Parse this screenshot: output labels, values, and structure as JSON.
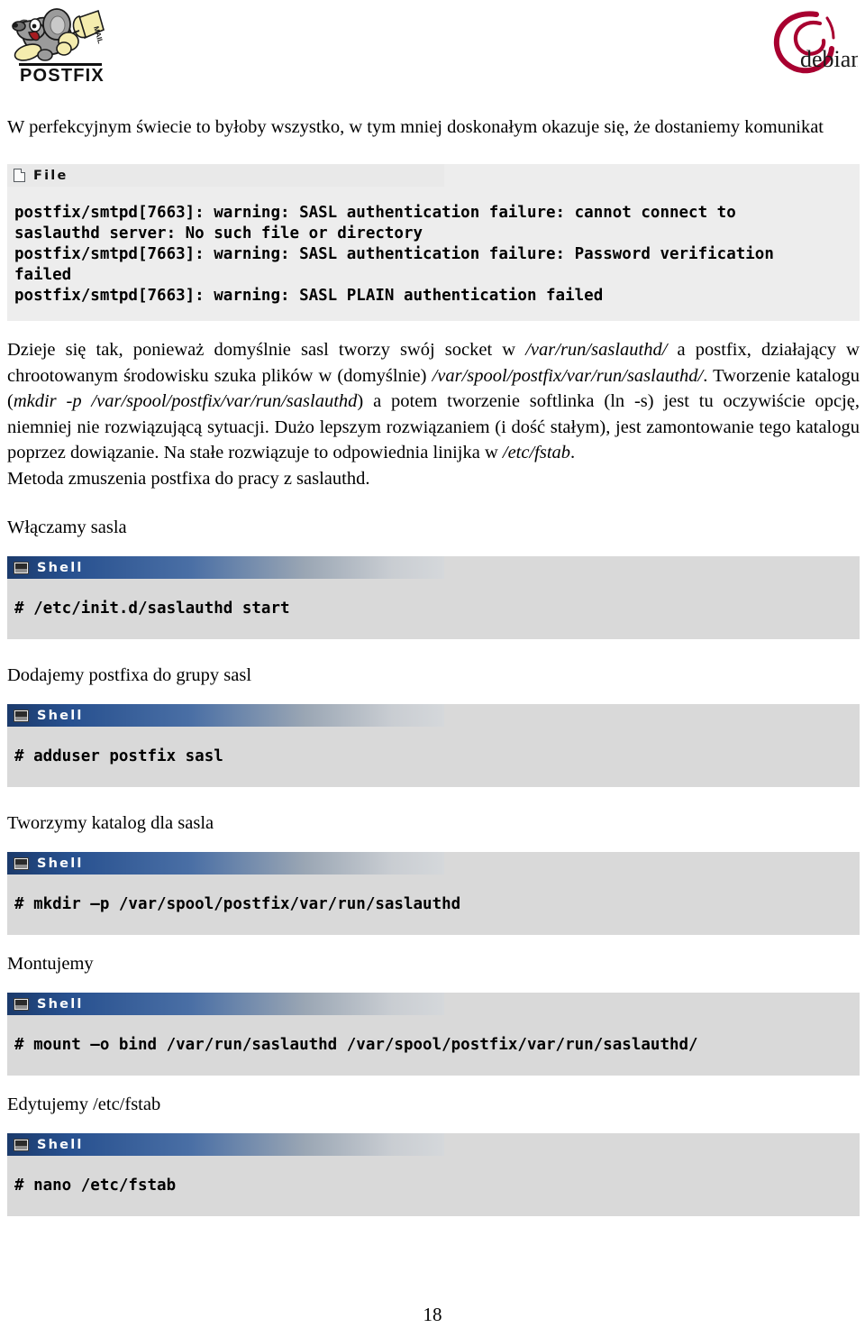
{
  "header": {
    "postfix_logo_alt": "POSTFIX",
    "postfix_wordmark": "POSTFIX",
    "debian_logo_alt": "debian",
    "debian_wordmark": "debian"
  },
  "intro": {
    "text": "W perfekcyjnym świecie to byłoby wszystko, w tym mniej doskonałym okazuje się, że dostaniemy komunikat"
  },
  "file_block": {
    "bar_label": "File",
    "bar_icon": "file-icon",
    "code": "postfix/smtpd[7663]: warning: SASL authentication failure: cannot connect to\nsaslauthd server: No such file or directory\npostfix/smtpd[7663]: warning: SASL authentication failure: Password verification\nfailed\npostfix/smtpd[7663]: warning: SASL PLAIN authentication failed"
  },
  "paragraph": {
    "p1_a": "Dzieje się tak, ponieważ domyślnie sasl tworzy swój socket w ",
    "p1_i1": "/var/run/saslauthd/",
    "p1_b": " a postfix, działający w chrootowanym środowisku szuka plików w (domyślnie) ",
    "p1_i2": "/var/spool/postfix/var/run/saslauthd/",
    "p1_c": ". Tworzenie katalogu (",
    "p1_i3": "mkdir -p /var/spool/postfix/var/run/saslauthd",
    "p1_d": ") a potem tworzenie softlinka (ln -s) jest tu oczywiście opcję, niemniej nie rozwiązującą sytuacji. Dużo lepszym rozwiązaniem (i dość stałym), jest zamontowanie tego katalogu poprzez dowiązanie. Na stałe rozwiązuje to odpowiednia linijka w ",
    "p1_i4": "/etc/fstab",
    "p1_e": ".",
    "p2": "Metoda zmuszenia postfixa do pracy z saslauthd."
  },
  "sections": [
    {
      "caption": "Włączamy sasla",
      "bar_label": "Shell",
      "bar_icon": "terminal-icon",
      "code": "# /etc/init.d/saslauthd start"
    },
    {
      "caption": "Dodajemy postfixa do grupy sasl",
      "bar_label": "Shell",
      "bar_icon": "terminal-icon",
      "code": "# adduser postfix sasl"
    },
    {
      "caption": "Tworzymy katalog dla sasla",
      "bar_label": "Shell",
      "bar_icon": "terminal-icon",
      "code": "# mkdir –p /var/spool/postfix/var/run/saslauthd"
    },
    {
      "caption": "Montujemy",
      "bar_label": "Shell",
      "bar_icon": "terminal-icon",
      "code": "# mount –o bind /var/run/saslauthd /var/spool/postfix/var/run/saslauthd/"
    },
    {
      "caption": "Edytujemy /etc/fstab",
      "bar_label": "Shell",
      "bar_icon": "terminal-icon",
      "code": "# nano /etc/fstab"
    }
  ],
  "footer": {
    "page_number": "18"
  },
  "colors": {
    "file_block_bg": "#ededed",
    "shell_block_bg": "#d9d9d9",
    "shell_bar_start": "#1b3a6b",
    "shell_bar_end": "#d5d8db",
    "debian_red": "#a80030",
    "postfix_gray": "#969696",
    "postfix_yellow": "#f3e8a8"
  }
}
